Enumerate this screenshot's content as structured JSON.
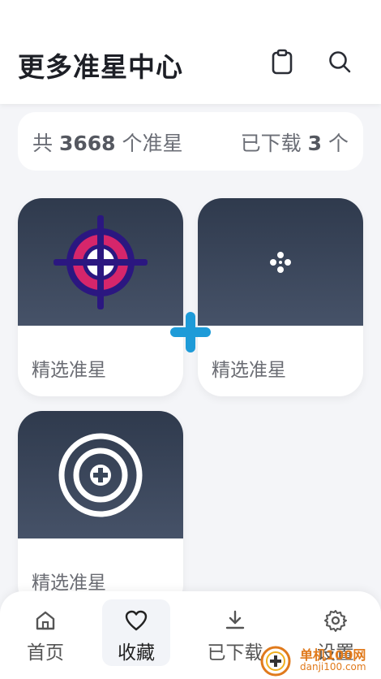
{
  "header": {
    "title": "更多准星中心"
  },
  "stats": {
    "total_prefix": "共",
    "total_count": "3668",
    "total_suffix": "个准星",
    "downloaded_prefix": "已下载",
    "downloaded_count": "3",
    "downloaded_suffix": "个"
  },
  "cards": [
    {
      "label": "精选准星",
      "icon": "crosshair-red-purple-icon"
    },
    {
      "label": "精选准星",
      "icon": "dot-cross-icon"
    },
    {
      "label": "精选准星",
      "icon": "ring-plus-icon"
    }
  ],
  "nav": [
    {
      "label": "首页",
      "icon": "home-icon"
    },
    {
      "label": "收藏",
      "icon": "heart-icon"
    },
    {
      "label": "已下载",
      "icon": "download-icon"
    },
    {
      "label": "设置",
      "icon": "gear-icon"
    }
  ],
  "watermark": {
    "title": "单机100网",
    "sub": "danji100.com"
  },
  "colors": {
    "accent_blue": "#1e9bd8",
    "card_dark": "#3a4659",
    "crosshair_red": "#d6266b",
    "crosshair_purple": "#2b1780"
  }
}
